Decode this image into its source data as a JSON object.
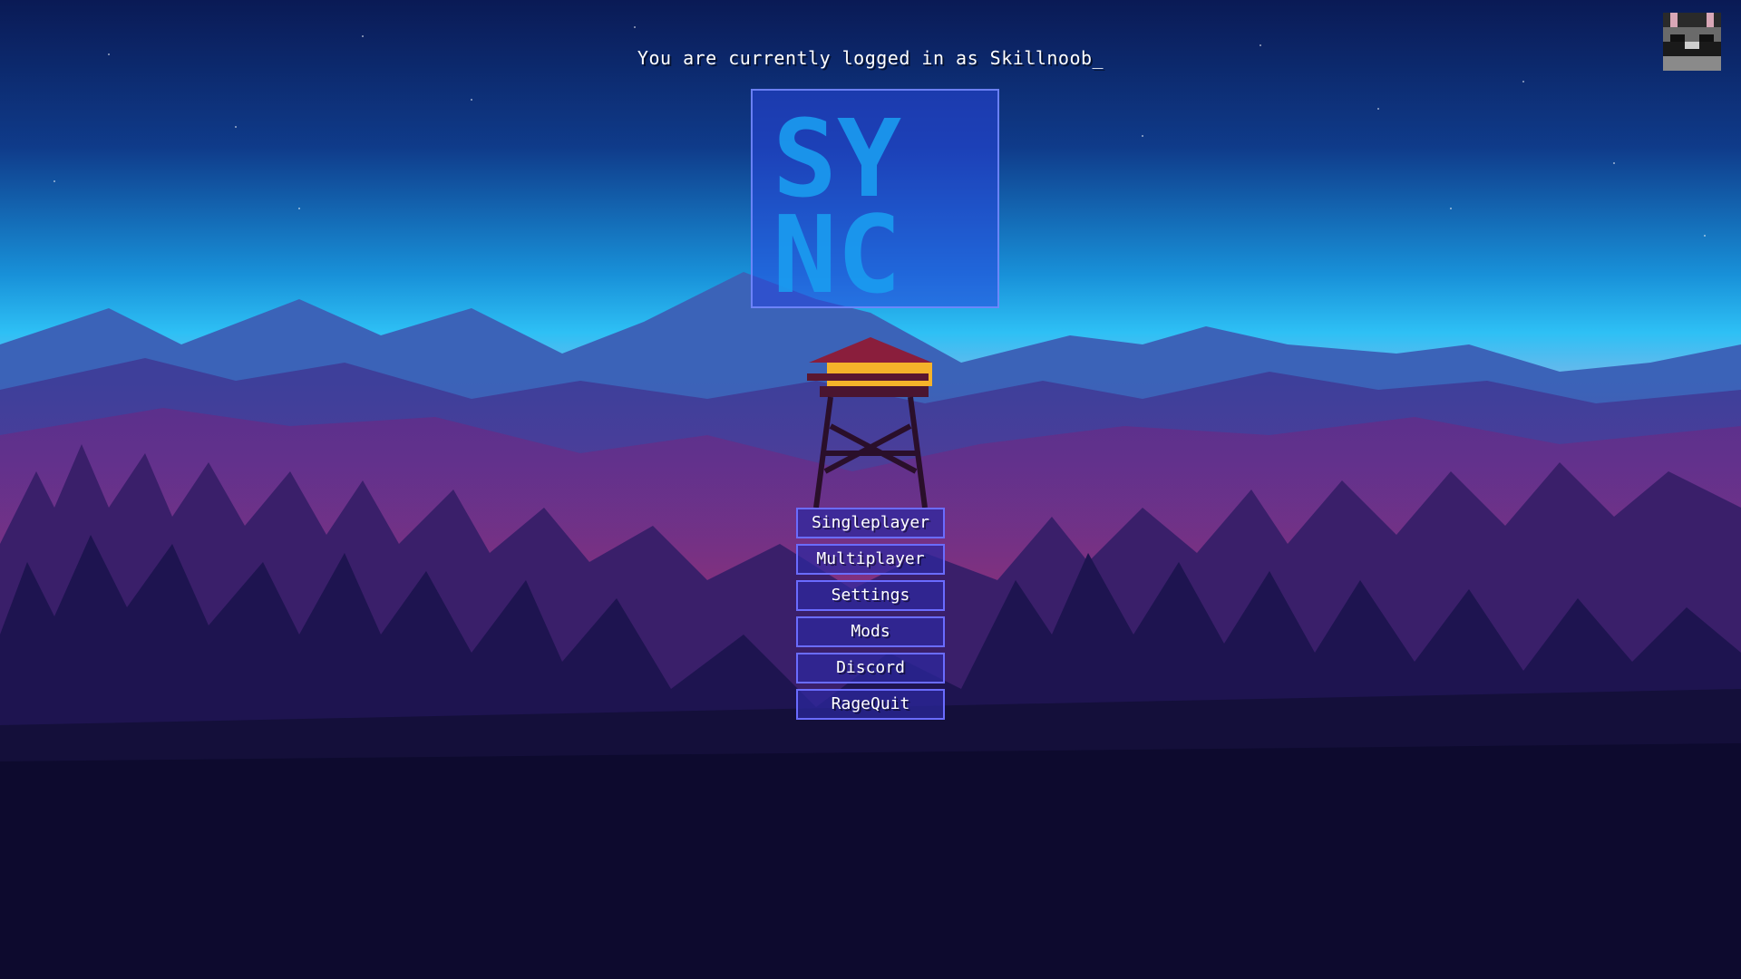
{
  "status": {
    "login_text": "You are currently logged in as Skillnoob_"
  },
  "logo": {
    "line1": "SY",
    "line2": "NC"
  },
  "menu": {
    "items": [
      {
        "label": "Singleplayer"
      },
      {
        "label": "Multiplayer"
      },
      {
        "label": "Settings"
      },
      {
        "label": "Mods"
      },
      {
        "label": "Discord"
      },
      {
        "label": "RageQuit"
      }
    ]
  },
  "colors": {
    "sky_top": "#0b1f5e",
    "sky_horizon": "#1fb4f0",
    "forest_dark": "#0d0a2e",
    "button_border": "#6a6cff",
    "logo_text": "#1a9cf0"
  },
  "icons": {
    "avatar": "player-head-icon"
  }
}
